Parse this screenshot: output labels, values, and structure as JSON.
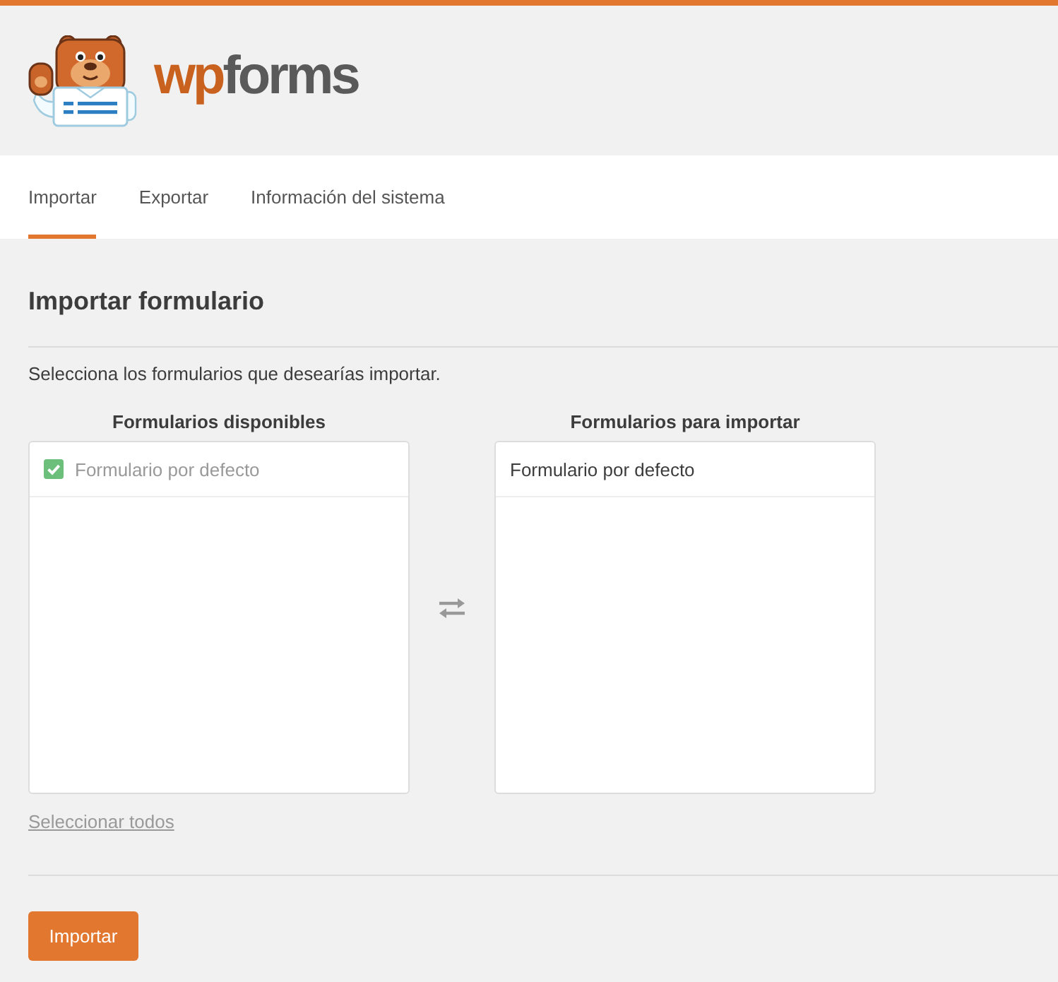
{
  "header": {
    "logo": {
      "accent": "wp",
      "rest": "forms"
    }
  },
  "tabs": [
    {
      "label": "Importar",
      "selected": true
    },
    {
      "label": "Exportar",
      "selected": false
    },
    {
      "label": "Información del sistema",
      "selected": false
    }
  ],
  "section": {
    "title": "Importar formulario",
    "description": "Selecciona los formularios que desearías importar."
  },
  "available": {
    "heading": "Formularios disponibles",
    "items": [
      {
        "label": "Formulario por defecto",
        "checked": true
      }
    ]
  },
  "to_import": {
    "heading": "Formularios para importar",
    "items": [
      {
        "label": "Formulario por defecto"
      }
    ]
  },
  "select_all_link": "Seleccionar todos",
  "submit_button": "Importar"
}
